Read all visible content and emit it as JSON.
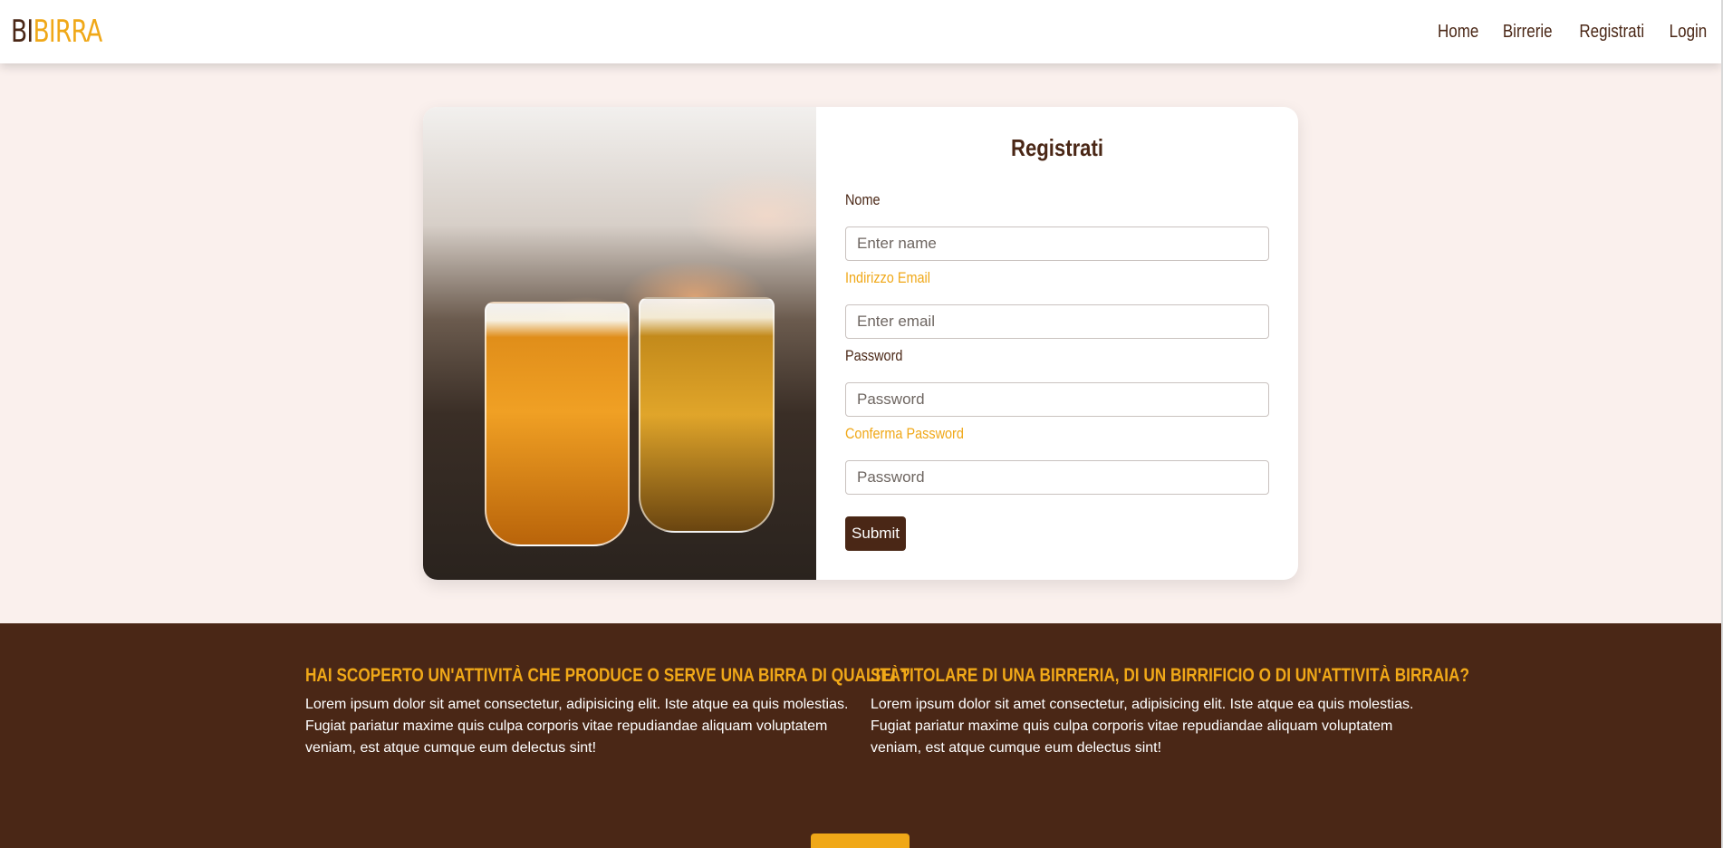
{
  "brand": {
    "part1": "BI",
    "part2": "BIRRA"
  },
  "nav": {
    "items": [
      "Home",
      "Birrerie",
      "Registrati",
      "Login"
    ]
  },
  "form": {
    "title": "Registrati",
    "name_label": "Nome",
    "name_placeholder": "Enter name",
    "email_label": "Indirizzo Email",
    "email_placeholder": "Enter email",
    "password_label": "Password",
    "password_placeholder": "Password",
    "confirm_label": "Conferma Password",
    "confirm_placeholder": "Password",
    "submit_label": "Submit"
  },
  "footer": {
    "left_title": "HAI SCOPERTO UN'ATTIVITÀ CHE PRODUCE O SERVE UNA BIRRA DI QUALITÀ?",
    "left_text": "Lorem ipsum dolor sit amet consectetur, adipisicing elit. Iste atque ea quis molestias. Fugiat pariatur maxime quis culpa corporis vitae repudiandae aliquam voluptatem veniam, est atque cumque eum delectus sint!",
    "right_title": "SEI TITOLARE DI UNA BIRRERIA, DI UN BIRRIFICIO O DI UN'ATTIVITÀ BIRRAIA?",
    "right_text": "Lorem ipsum dolor sit amet consectetur, adipisicing elit. Iste atque ea quis molestias. Fugiat pariatur maxime quis culpa corporis vitae repudiandae aliquam voluptatem veniam, est atque cumque eum delectus sint!"
  },
  "colors": {
    "brown": "#4a2716",
    "gold": "#f0a818",
    "background": "#faf0ed"
  }
}
